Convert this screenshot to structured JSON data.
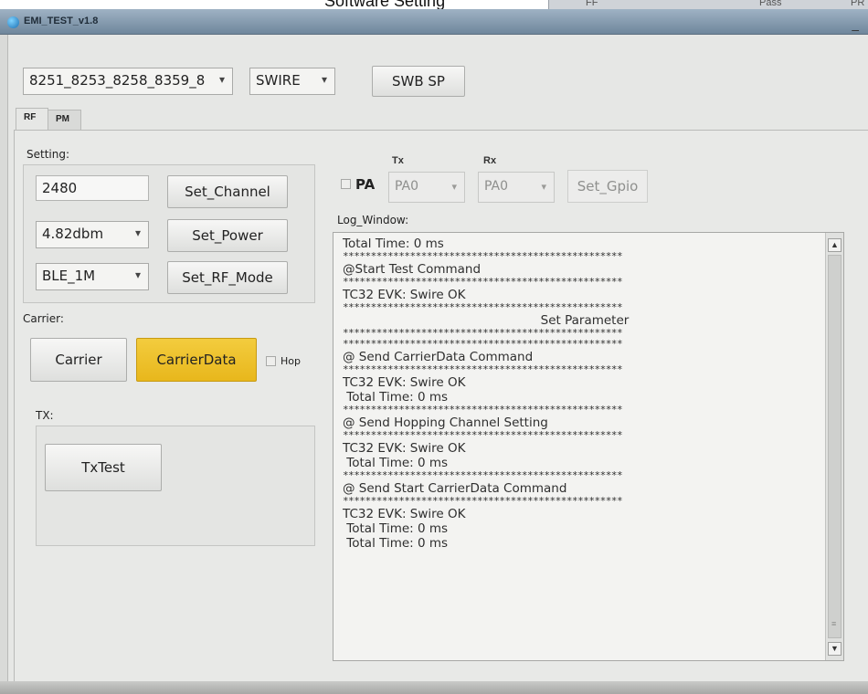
{
  "caption": "Software Setting",
  "background_window": {
    "col1": "FF",
    "col2": "Pass",
    "col3": "PR"
  },
  "window": {
    "title": "EMI_TEST_v1.8",
    "minimize": "–"
  },
  "toolbar": {
    "chip_select": "8251_8253_8258_8359_8",
    "interface_select": "SWIRE",
    "swb_button": "SWB SP"
  },
  "tabs": [
    {
      "label": "RF"
    },
    {
      "label": "PM"
    }
  ],
  "setting": {
    "label": "Setting:",
    "channel_value": "2480",
    "set_channel": "Set_Channel",
    "power_value": "4.82dbm",
    "set_power": "Set_Power",
    "rf_mode_value": "BLE_1M",
    "set_rf_mode": "Set_RF_Mode"
  },
  "carrier": {
    "label": "Carrier:",
    "carrier_button": "Carrier",
    "carrierdata_button": "CarrierData",
    "hop_label": "Hop"
  },
  "tx": {
    "label": "TX:",
    "txtest_button": "TxTest"
  },
  "gpio": {
    "tx_label": "Tx",
    "rx_label": "Rx",
    "pa_label": "PA",
    "tx_value": "PA0",
    "rx_value": "PA0",
    "set_gpio": "Set_Gpio"
  },
  "log": {
    "label": "Log_Window:",
    "lines": [
      {
        "text": "Total Time: 0 ms",
        "kind": "text"
      },
      {
        "text": "**************************************************",
        "kind": "stars"
      },
      {
        "text": "@Start Test Command",
        "kind": "text"
      },
      {
        "text": "**************************************************",
        "kind": "stars"
      },
      {
        "text": "TC32 EVK: Swire OK",
        "kind": "text"
      },
      {
        "text": "**************************************************",
        "kind": "stars"
      },
      {
        "text": "Set Parameter",
        "kind": "center"
      },
      {
        "text": "**************************************************",
        "kind": "stars"
      },
      {
        "text": "**************************************************",
        "kind": "stars"
      },
      {
        "text": "@ Send CarrierData Command",
        "kind": "text"
      },
      {
        "text": "**************************************************",
        "kind": "stars"
      },
      {
        "text": "TC32 EVK: Swire OK",
        "kind": "text"
      },
      {
        "text": " Total Time: 0 ms",
        "kind": "text"
      },
      {
        "text": "**************************************************",
        "kind": "stars"
      },
      {
        "text": "@ Send Hopping Channel Setting",
        "kind": "text"
      },
      {
        "text": "**************************************************",
        "kind": "stars"
      },
      {
        "text": "TC32 EVK: Swire OK",
        "kind": "text"
      },
      {
        "text": " Total Time: 0 ms",
        "kind": "text"
      },
      {
        "text": "**************************************************",
        "kind": "stars"
      },
      {
        "text": "@ Send Start CarrierData Command",
        "kind": "text"
      },
      {
        "text": "**************************************************",
        "kind": "stars"
      },
      {
        "text": "TC32 EVK: Swire OK",
        "kind": "text"
      },
      {
        "text": " Total Time: 0 ms",
        "kind": "text"
      },
      {
        "text": " Total Time: 0 ms",
        "kind": "text"
      }
    ]
  },
  "icons": {
    "dropdown": "▾",
    "scroll_up": "▲",
    "scroll_down": "▼",
    "grip": "≡"
  },
  "colors": {
    "accent_yellow": "#e8b71c",
    "titlebar": "#7f96ab",
    "window_bg": "#e6e7e5"
  }
}
